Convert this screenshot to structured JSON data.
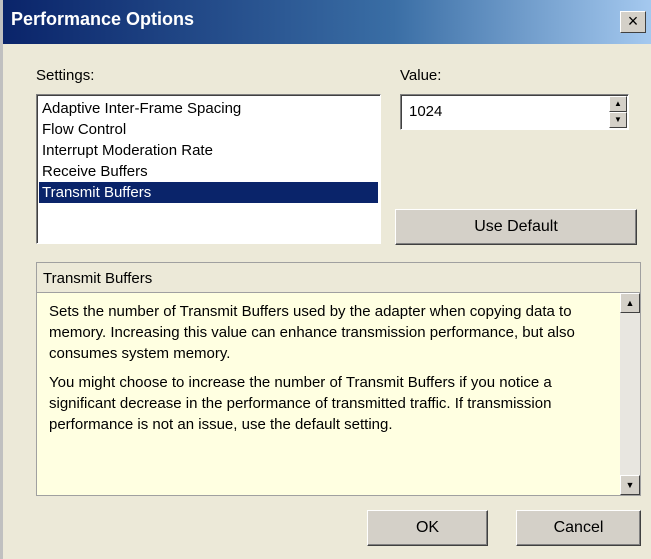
{
  "window": {
    "title": "Performance Options",
    "close_glyph": "×"
  },
  "settings": {
    "label": "Settings:",
    "items": [
      "Adaptive Inter-Frame Spacing",
      "Flow Control",
      "Interrupt Moderation Rate",
      "Receive Buffers",
      "Transmit Buffers"
    ],
    "selected": "Transmit Buffers"
  },
  "value": {
    "label": "Value:",
    "current": "1024"
  },
  "buttons": {
    "use_default": "Use Default",
    "ok": "OK",
    "cancel": "Cancel"
  },
  "description": {
    "title": "Transmit Buffers",
    "paragraphs": [
      "Sets the number of Transmit Buffers used by the adapter when copying data to memory. Increasing this value can enhance transmission performance, but also consumes system memory.",
      "You might choose to increase the number of Transmit Buffers if you notice a significant decrease in the performance of transmitted traffic. If transmission performance is not an issue, use the default setting."
    ]
  },
  "icons": {
    "close": "close-icon",
    "spin_up": "arrow-up-icon",
    "spin_down": "arrow-down-icon",
    "scroll_up": "scroll-up-icon",
    "scroll_down": "scroll-down-icon"
  },
  "colors": {
    "titlebar": "#0a246a",
    "selection": "#0a246a",
    "dialog_face": "#ece9d8",
    "tooltip_bg": "#ffffe1"
  }
}
